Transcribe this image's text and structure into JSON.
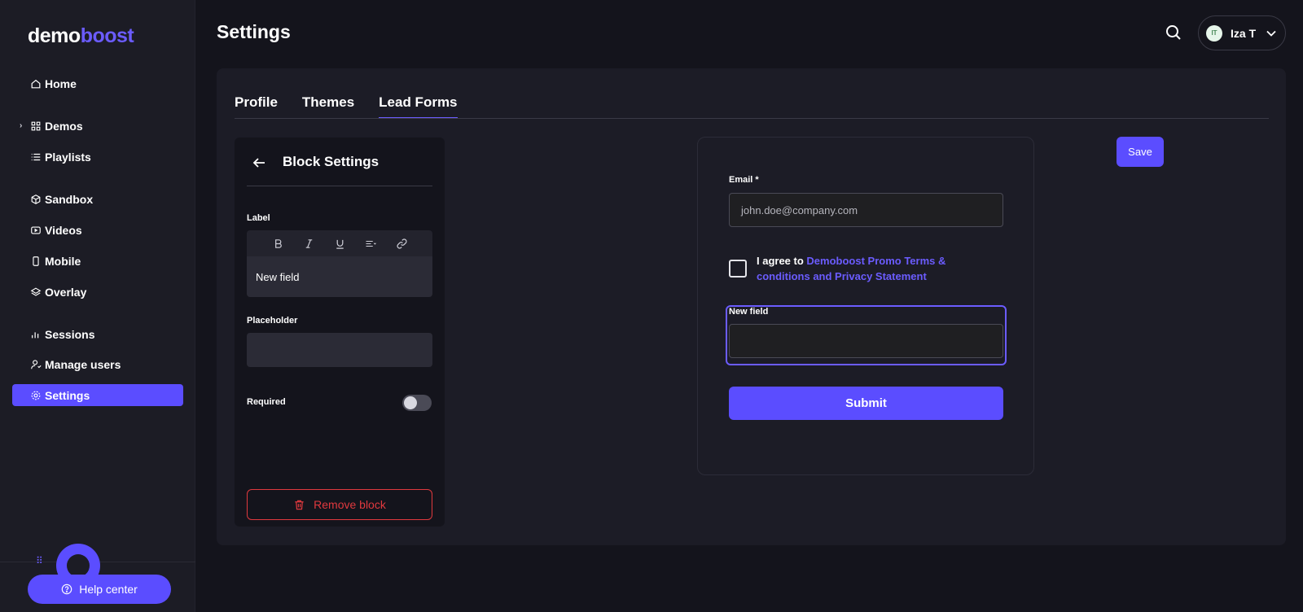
{
  "app": {
    "logo_part1": "demo",
    "logo_part2": "boost"
  },
  "sidebar": {
    "items": [
      {
        "label": "Home",
        "icon": "home-icon"
      },
      {
        "label": "Demos",
        "icon": "grid-icon"
      },
      {
        "label": "Playlists",
        "icon": "list-icon"
      },
      {
        "label": "Sandbox",
        "icon": "cube-icon"
      },
      {
        "label": "Videos",
        "icon": "video-icon"
      },
      {
        "label": "Mobile",
        "icon": "mobile-icon"
      },
      {
        "label": "Overlay",
        "icon": "layers-icon"
      },
      {
        "label": "Sessions",
        "icon": "bar-chart-icon"
      },
      {
        "label": "Manage users",
        "icon": "user-icon"
      },
      {
        "label": "Settings",
        "icon": "gear-icon",
        "active": true
      }
    ],
    "help_label": "Help center"
  },
  "header": {
    "title": "Settings",
    "user": {
      "initials": "IT",
      "name": "Iza T"
    }
  },
  "tabs": [
    {
      "label": "Profile"
    },
    {
      "label": "Themes"
    },
    {
      "label": "Lead Forms",
      "active": true
    }
  ],
  "block_settings": {
    "title": "Block Settings",
    "label_heading": "Label",
    "label_value": "New field",
    "placeholder_heading": "Placeholder",
    "placeholder_value": "",
    "required_label": "Required",
    "required_on": false,
    "remove_label": "Remove block"
  },
  "form": {
    "email_label": "Email *",
    "email_placeholder": "john.doe@company.com",
    "agree_prefix": "I agree to ",
    "agree_link": "Demoboost Promo Terms & conditions and Privacy Statement",
    "new_field_label": "New field",
    "submit_label": "Submit"
  },
  "save_label": "Save",
  "colors": {
    "accent": "#5b4dff",
    "danger": "#e0393e",
    "background": "#14141c",
    "panel": "#1c1c26"
  }
}
